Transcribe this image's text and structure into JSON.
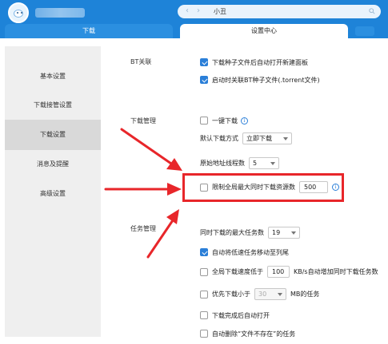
{
  "header": {
    "address_text": "小丑",
    "back_icon": "chevron-left-icon",
    "forward_icon": "chevron-right-icon",
    "search_icon": "search-icon",
    "brand_color": "#1e83d8"
  },
  "tabs": [
    {
      "label": "下载",
      "active": false
    },
    {
      "label": "设置中心",
      "active": true
    }
  ],
  "sidebar": {
    "items": [
      {
        "label": "基本设置",
        "active": false
      },
      {
        "label": "下载接管设置",
        "active": false
      },
      {
        "label": "下载设置",
        "active": true
      },
      {
        "label": "消息及提醒",
        "active": false
      },
      {
        "label": "高级设置",
        "active": false
      }
    ]
  },
  "bt": {
    "title": "BT关联",
    "opt_open_panel": {
      "label": "下载种子文件后自动打开新建面板",
      "checked": true
    },
    "opt_associate": {
      "label": "启动时关联BT种子文件(.torrent文件)",
      "checked": true
    }
  },
  "download_mgmt": {
    "title": "下载管理",
    "one_click": {
      "label": "一键下载",
      "checked": false
    },
    "default_mode_label": "默认下载方式",
    "default_mode_value": "立即下载",
    "threads_label": "原始地址线程数",
    "threads_value": "5",
    "limit_resources": {
      "label": "限制全局最大同时下载资源数",
      "checked": false,
      "value": "500"
    }
  },
  "task_mgmt": {
    "title": "任务管理",
    "max_tasks_label": "同时下载的最大任务数",
    "max_tasks_value": "19",
    "auto_move_slow": {
      "label": "自动将低速任务移动至列尾",
      "checked": true
    },
    "speed_below": {
      "prefix": "全局下载速度低于",
      "value": "100",
      "suffix": "KB/s自动增加同时下载任务数",
      "checked": false
    },
    "small_first": {
      "prefix": "优先下载小于",
      "value": "30",
      "suffix": "MB的任务",
      "checked": false
    },
    "auto_open": {
      "label": "下载完成后自动打开",
      "checked": false
    },
    "auto_delete": {
      "label": "自动删除“文件不存在”的任务",
      "checked": false
    }
  },
  "annotation": {
    "color": "#e8262a"
  }
}
